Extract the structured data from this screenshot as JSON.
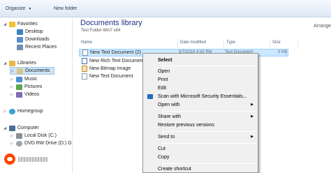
{
  "toolbar": {
    "organize": "Organize",
    "new_folder": "New folder",
    "arrange": "Arrange"
  },
  "nav": {
    "favorites": "Favorites",
    "desktop": "Desktop",
    "downloads": "Downloads",
    "recent": "Recent Places",
    "libraries": "Libraries",
    "documents": "Documents",
    "music": "Music",
    "pictures": "Pictures",
    "videos": "Videos",
    "homegroup": "Homegroup",
    "computer": "Computer",
    "local_disk": "Local Disk (C:)",
    "dvd": "DVD RW Drive (D:) G"
  },
  "library": {
    "title": "Documents library",
    "subtitle": "Test Folder Win7 x64"
  },
  "columns": {
    "name": "Name",
    "date": "Date modified",
    "type": "Type",
    "size": "Size"
  },
  "files": [
    {
      "name": "New Text Document (2)",
      "date": "5/7/2019 4:42 PM",
      "type": "Text Document",
      "size": "0 KB"
    },
    {
      "name": "New Rich Text Document",
      "date": "",
      "type": "",
      "size": ""
    },
    {
      "name": "New Bitmap Image",
      "date": "",
      "type": "",
      "size": ""
    },
    {
      "name": "New Text Document",
      "date": "",
      "type": "",
      "size": ""
    }
  ],
  "context_menu": {
    "select": "Select",
    "open": "Open",
    "print": "Print",
    "edit": "Edit",
    "scan": "Scan with Microsoft Security Essentials...",
    "open_with": "Open with",
    "share_with": "Share with",
    "restore": "Restore previous versions",
    "send_to": "Send to",
    "cut": "Cut",
    "copy": "Copy",
    "create_shortcut": "Create shortcut"
  },
  "colors": {
    "accent": "#1e3287",
    "selection": "#cce8ff"
  }
}
